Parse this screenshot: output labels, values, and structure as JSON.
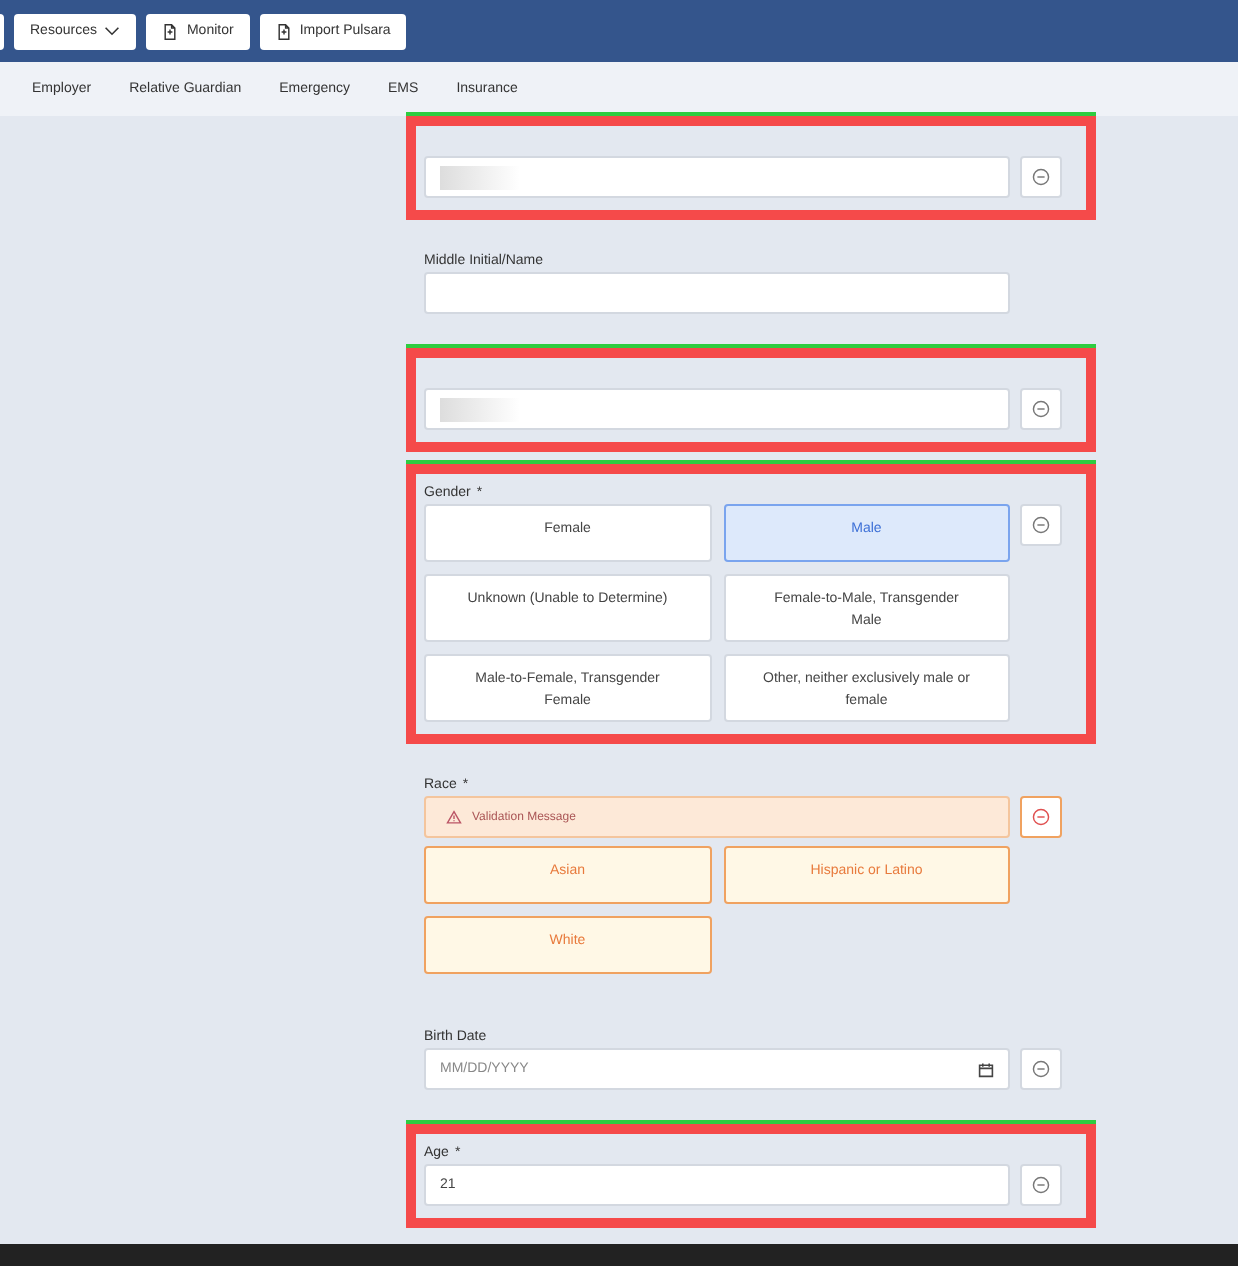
{
  "toolbar": {
    "buttons": [
      {
        "label": "Resources",
        "kind": "dropdown"
      },
      {
        "label": "Monitor",
        "kind": "document"
      },
      {
        "label": "Import Pulsara",
        "kind": "document"
      }
    ]
  },
  "tabs": [
    {
      "label": "Employer",
      "selected": false
    },
    {
      "label": "Relative Guardian",
      "selected": false
    },
    {
      "label": "Emergency",
      "selected": false
    },
    {
      "label": "EMS",
      "selected": false
    },
    {
      "label": "Insurance",
      "selected": false
    }
  ],
  "fields": [
    {
      "kind": "text",
      "highlighted": true,
      "redacted": true,
      "removable": true
    },
    {
      "kind": "text",
      "label": "Middle Initial/Name",
      "highlighted": false,
      "removable": false
    },
    {
      "kind": "text",
      "highlighted": true,
      "redacted": true,
      "removable": true
    },
    {
      "kind": "options",
      "label": "Gender",
      "required_mark": "*",
      "highlighted": true,
      "removable": true,
      "options": [
        {
          "label": "Female",
          "selected": false
        },
        {
          "label": "Male",
          "selected": true
        },
        {
          "label": "Unknown (Unable to Determine)",
          "selected": false
        },
        {
          "label": "Female-to-Male, Transgender Male",
          "selected": false
        },
        {
          "label": "Male-to-Female, Transgender Female",
          "selected": false
        },
        {
          "label": "Other, neither exclusively male or female",
          "selected": false
        }
      ]
    },
    {
      "kind": "options",
      "label": "Race",
      "required_mark": "*",
      "highlighted": false,
      "removable": true,
      "error": true,
      "validation": "Validation Message",
      "options": [
        {
          "label": "Asian",
          "selected": false
        },
        {
          "label": "Hispanic or Latino",
          "selected": false
        },
        {
          "label": "White",
          "selected": false
        }
      ]
    },
    {
      "kind": "date",
      "label": "Birth Date",
      "placeholder": "MM/DD/YYYY",
      "highlighted": false,
      "removable": true
    },
    {
      "kind": "text",
      "label": "Age",
      "required_mark": "*",
      "value": "21",
      "highlighted": true,
      "removable": true
    }
  ]
}
